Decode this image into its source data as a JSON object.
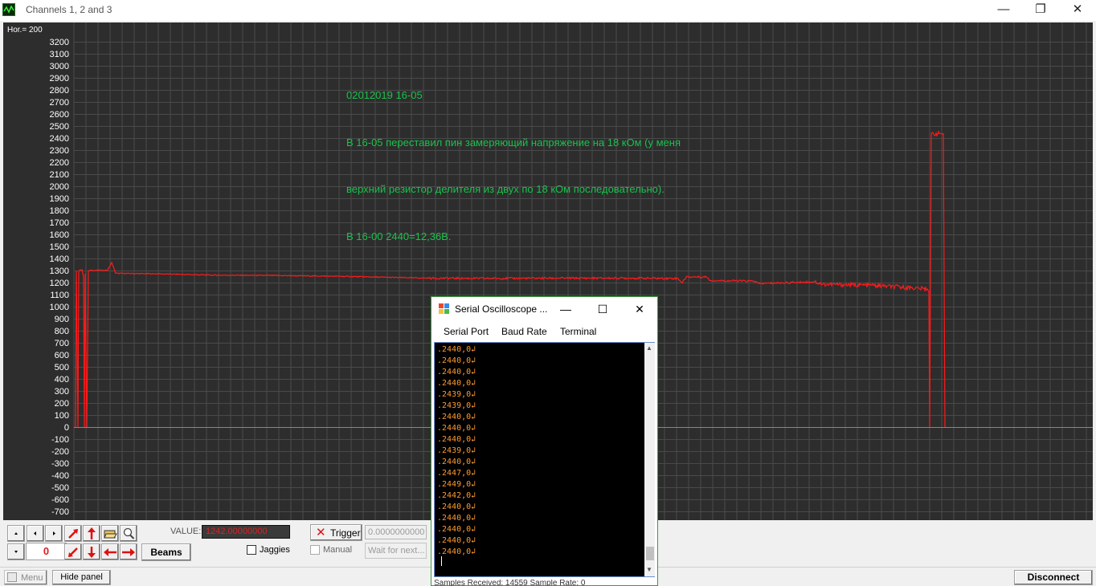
{
  "window": {
    "title": "Channels 1, 2 and 3",
    "controls": {
      "minimize": "—",
      "restore": "❐",
      "close": "✕"
    }
  },
  "scope": {
    "hor_label": "Hor.= 200",
    "background_color": "#2d2d2d",
    "grid_color": "#4a4a4a",
    "trace_color": "#ff1a1a",
    "zero_line_color": "#1fb89a",
    "annotation_color": "#18c24a",
    "annotation_lines": [
      "02012019 16-05",
      "В 16-05 переставил пин замеряющий напряжение на 18 кОм (у меня",
      "верхний резистор делителя из двух по 18 кОм последовательно).",
      "В 16-00 2440=12,36В."
    ]
  },
  "chart_data": {
    "type": "line",
    "y_ticks": [
      3200,
      3100,
      3000,
      2900,
      2800,
      2700,
      2600,
      2500,
      2400,
      2300,
      2200,
      2100,
      2000,
      1900,
      1800,
      1700,
      1600,
      1500,
      1400,
      1300,
      1200,
      1100,
      1000,
      900,
      800,
      700,
      600,
      500,
      400,
      300,
      200,
      100,
      0,
      -100,
      -200,
      -300,
      -400,
      -500,
      -600,
      -700
    ],
    "ylim": [
      -750,
      3250
    ],
    "xlim": [
      0,
      1356
    ],
    "grid": true,
    "series": [
      {
        "color": "#ff1a1a",
        "points": [
          [
            88,
            0
          ],
          [
            90,
            0
          ],
          [
            91,
            1300
          ],
          [
            93,
            0
          ],
          [
            94,
            1300
          ],
          [
            98,
            1310
          ],
          [
            100,
            1250
          ],
          [
            101,
            0
          ],
          [
            102,
            1280
          ],
          [
            104,
            0
          ],
          [
            106,
            1300
          ],
          [
            110,
            1305
          ],
          [
            130,
            1305
          ],
          [
            135,
            1370
          ],
          [
            140,
            1280
          ],
          [
            200,
            1275
          ],
          [
            260,
            1265
          ],
          [
            340,
            1262
          ],
          [
            420,
            1255
          ],
          [
            470,
            1248
          ],
          [
            530,
            1240
          ],
          [
            600,
            1238
          ],
          [
            700,
            1240
          ],
          [
            780,
            1240
          ],
          [
            840,
            1238
          ],
          [
            845,
            1200
          ],
          [
            850,
            1250
          ],
          [
            875,
            1250
          ],
          [
            880,
            1220
          ],
          [
            935,
            1215
          ],
          [
            940,
            1195
          ],
          [
            1010,
            1210
          ],
          [
            1020,
            1190
          ],
          [
            1080,
            1180
          ],
          [
            1130,
            1160
          ],
          [
            1150,
            1150
          ],
          [
            1152,
            1130
          ],
          [
            1153,
            0
          ],
          [
            1155,
            2440
          ],
          [
            1170,
            2440
          ],
          [
            1172,
            0
          ]
        ]
      },
      {
        "color": "#1fb89a",
        "points": [
          [
            88,
            0
          ],
          [
            1356,
            0
          ]
        ]
      }
    ]
  },
  "panel": {
    "value_label": "VALUE:",
    "value": "1242.00000000",
    "counter": "0",
    "beams_label": "Beams",
    "jaggies_label": "Jaggies",
    "trigger_label": "Trigger",
    "trigger_value": "0.0000000000",
    "manual_label": "Manual",
    "wait_label": "Wait for next..."
  },
  "statusbar": {
    "menu_label": "Menu",
    "hide_panel_label": "Hide panel",
    "disconnect_label": "Disconnect"
  },
  "dialog": {
    "title": "Serial Oscilloscope ...",
    "menu": [
      "Serial Port",
      "Baud Rate",
      "Terminal"
    ],
    "lines": [
      ".2440,0↲",
      ".2440,0↲",
      ".2440,0↲",
      ".2440,0↲",
      ".2439,0↲",
      ".2439,0↲",
      ".2440,0↲",
      ".2440,0↲",
      ".2440,0↲",
      ".2439,0↲",
      ".2440,0↲",
      ".2447,0↲",
      ".2449,0↲",
      ".2442,0↲",
      ".2440,0↲",
      ".2440,0↲",
      ".2440,0↲",
      ".2440,0↲",
      ".2440,0↲"
    ],
    "status": "Samples Received: 14559  Sample Rate: 0"
  }
}
